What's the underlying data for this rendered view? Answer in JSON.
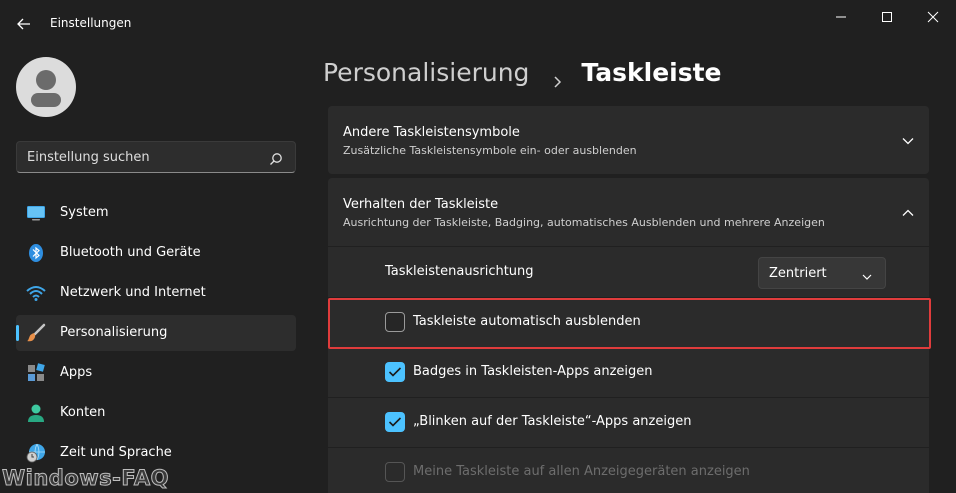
{
  "window": {
    "title": "Einstellungen"
  },
  "sidebar": {
    "search_placeholder": "Einstellung suchen",
    "items": [
      {
        "label": "System",
        "icon": "monitor-icon",
        "active": false
      },
      {
        "label": "Bluetooth und Geräte",
        "icon": "bluetooth-icon",
        "active": false
      },
      {
        "label": "Netzwerk und Internet",
        "icon": "wifi-icon",
        "active": false
      },
      {
        "label": "Personalisierung",
        "icon": "brush-icon",
        "active": true
      },
      {
        "label": "Apps",
        "icon": "apps-icon",
        "active": false
      },
      {
        "label": "Konten",
        "icon": "person-icon",
        "active": false
      },
      {
        "label": "Zeit und Sprache",
        "icon": "globe-clock-icon",
        "active": false
      }
    ]
  },
  "watermark": "Windows-FAQ",
  "breadcrumb": {
    "parent": "Personalisierung",
    "current": "Taskleiste"
  },
  "sections": [
    {
      "title": "Andere Taskleistensymbole",
      "subtitle": "Zusätzliche Taskleistensymbole ein- oder ausblenden",
      "expanded": false
    },
    {
      "title": "Verhalten der Taskleiste",
      "subtitle": "Ausrichtung der Taskleiste, Badging, automatisches Ausblenden und mehrere Anzeigen",
      "expanded": true
    }
  ],
  "settings": {
    "alignment": {
      "label": "Taskleistenausrichtung",
      "value": "Zentriert"
    },
    "autohide": {
      "label": "Taskleiste automatisch ausblenden",
      "checked": false,
      "disabled": false
    },
    "badges": {
      "label": "Badges in Taskleisten-Apps anzeigen",
      "checked": true,
      "disabled": false
    },
    "flashing": {
      "label": "„Blinken auf der Taskleiste“-Apps anzeigen",
      "checked": true,
      "disabled": false
    },
    "all_displays": {
      "label": "Meine Taskleiste auf allen Anzeigegeräten anzeigen",
      "checked": false,
      "disabled": true
    }
  },
  "colors": {
    "accent": "#4cc2ff",
    "highlight": "#e03c3c",
    "background": "#202020",
    "card": "#2b2b2b"
  }
}
